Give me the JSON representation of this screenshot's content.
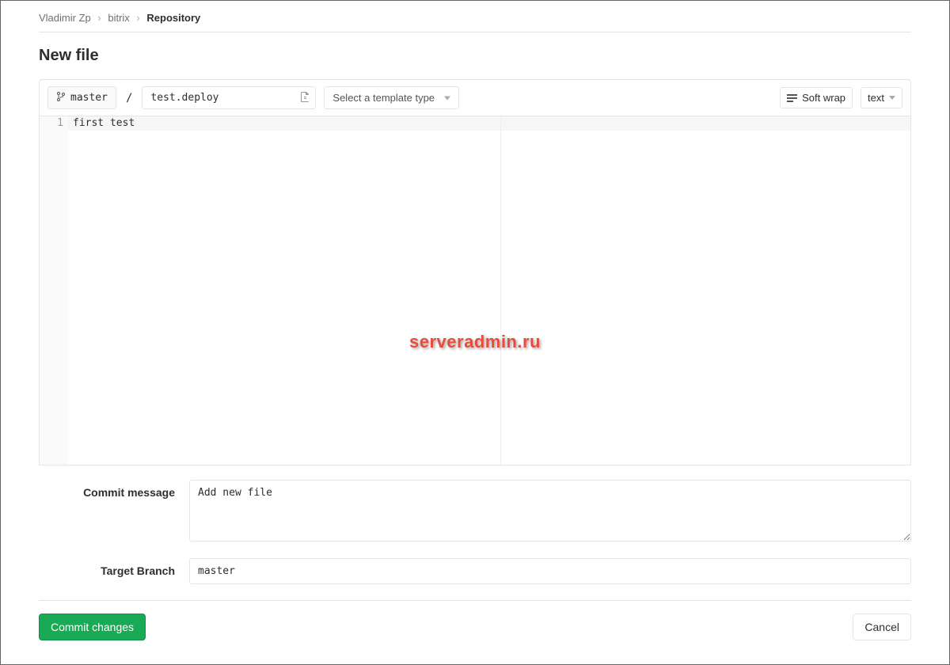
{
  "breadcrumb": {
    "owner": "Vladimir Zp",
    "project": "bitrix",
    "page": "Repository"
  },
  "page_title": "New file",
  "toolbar": {
    "branch": "master",
    "path_separator": "/",
    "filename": "test.deploy",
    "template_placeholder": "Select a template type",
    "soft_wrap_label": "Soft wrap",
    "syntax_label": "text"
  },
  "editor": {
    "lines": [
      "first test"
    ]
  },
  "form": {
    "commit_message_label": "Commit message",
    "commit_message_value": "Add new file",
    "target_branch_label": "Target Branch",
    "target_branch_value": "master"
  },
  "actions": {
    "commit_label": "Commit changes",
    "cancel_label": "Cancel"
  },
  "watermark": "serveradmin.ru"
}
